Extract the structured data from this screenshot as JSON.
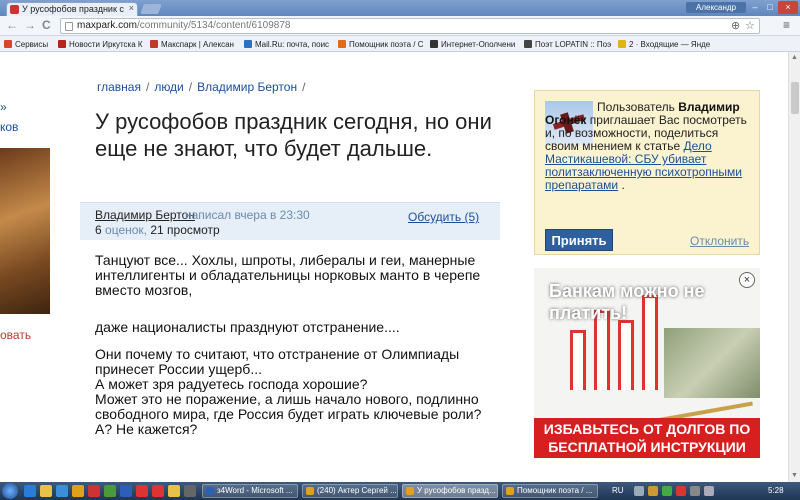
{
  "browser": {
    "tab_title": "У русофобов праздник с",
    "tab_close": "×",
    "user_name": "Александр",
    "win_min": "–",
    "win_max": "□",
    "win_close": "×",
    "back": "←",
    "forward": "→",
    "reload": "C",
    "url_domain": "maxpark.com",
    "url_path": "/community/5134/content/6109878",
    "zoom_glyph": "⊕",
    "star_glyph": "☆",
    "wrench": "≡"
  },
  "bookmarks": [
    {
      "label": "Сервисы",
      "color": "#d9432e"
    },
    {
      "label": "Новости Иркутска К",
      "color": "#b3261e"
    },
    {
      "label": "Макспарк | Алексан",
      "color": "#c0392b"
    },
    {
      "label": "Mail.Ru: почта, поис",
      "color": "#2d6fc0"
    },
    {
      "label": "Помощник поэта / С",
      "color": "#e06a1a"
    },
    {
      "label": "Интернет-Ополчени",
      "color": "#333333"
    },
    {
      "label": "Поэт LOPATIN :: Поэ",
      "color": "#444444"
    },
    {
      "label": "2 · Входящие — Янде",
      "color": "#e2b21a"
    }
  ],
  "left_fragments": {
    "link1": "»",
    "link2": "ков",
    "red": "овать"
  },
  "breadcrumb": {
    "home": "главная",
    "people": "люди",
    "author": "Владимир Бертон",
    "sep": "/"
  },
  "article": {
    "title": "У русофобов праздник сегодня, но они еще не знают, что будет дальше.",
    "author": "Владимир Бертон",
    "wrote": "написал вчера в 23:30",
    "ratings_num": "6",
    "ratings_label": "оценок,",
    "views": "21 просмотр",
    "discuss": "Обсудить (5)",
    "p1": "Танцуют все... Хохлы, шпроты, либералы и геи, манерные интеллигенты и обладательницы норковых манто в черепе вместо мозгов,",
    "p2": "даже националисты празднуют отстранение....",
    "p3": " Они почему то считают, что отстранение от Олимпиады принесет России ущерб...",
    "p4": "А может зря радуетесь господа хорошие?",
    "p5": "Может это не поражение, а лишь начало нового, подлинно свободного мира, где Россия будет играть ключевые роли?",
    "p6": "А? Не кажется?"
  },
  "invite": {
    "text1": "Пользователь",
    "user": "Владимир Огонёк",
    "text2": "приглашает Вас посмотреть и, по возможности, поделиться своим мнением к статье",
    "link": "Дело Мастикашевой: СБУ убивает политзаключенную психотропными препаратами",
    "dot": ".",
    "accept": "Принять",
    "decline": "Отклонить"
  },
  "ad": {
    "headline": "Банкам можно не платить!",
    "footer": "ИЗБАВЬТЕСЬ ОТ ДОЛГОВ ПО БЕСПЛАТНОЙ ИНСТРУКЦИИ",
    "close": "×"
  },
  "taskbar": {
    "tasks": [
      {
        "label": "з4Word - Microsoft ...",
        "color": "#2b5fb8"
      },
      {
        "label": "(240) Актер Сергей ...",
        "color": "#e0a01a"
      },
      {
        "label": "У русофобов празд...",
        "color": "#e0a01a"
      },
      {
        "label": "Помощник поэта / ...",
        "color": "#e0a01a"
      }
    ],
    "lang": "RU",
    "time": "5:28"
  }
}
